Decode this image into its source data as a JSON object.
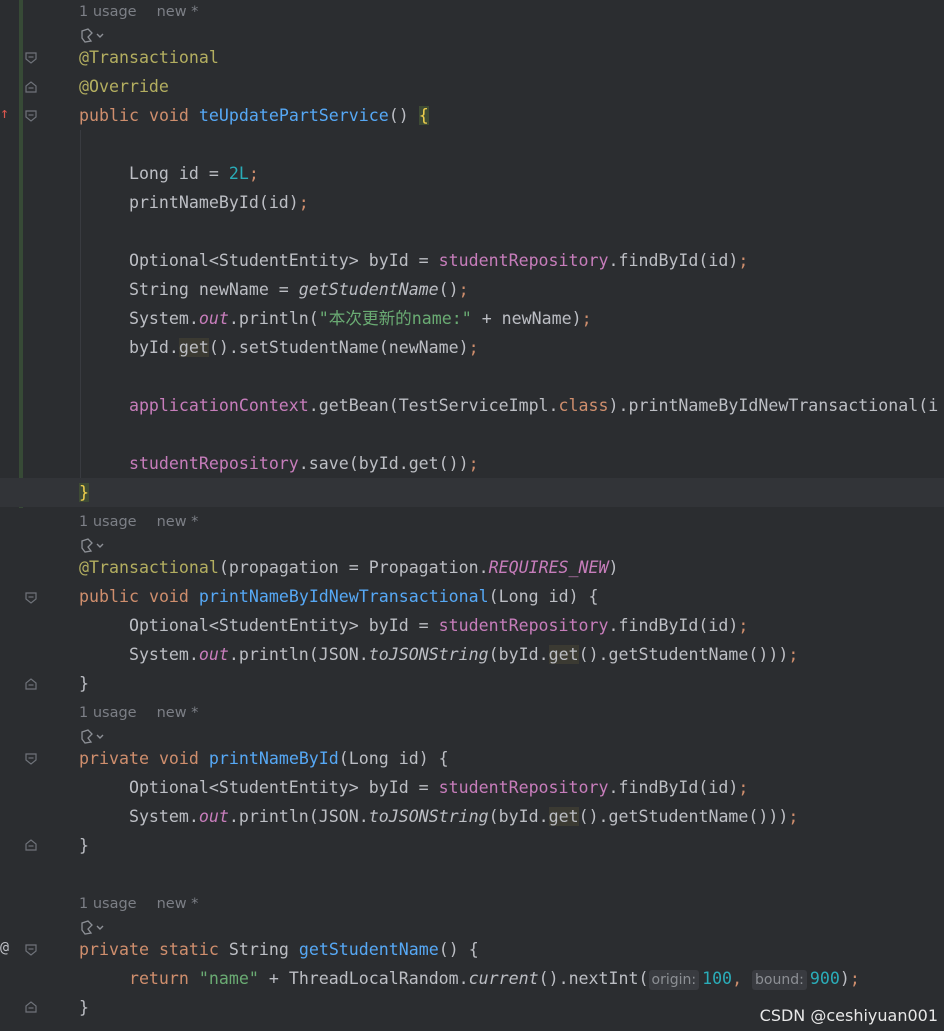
{
  "hints": {
    "usage": "1 usage",
    "new": "new *"
  },
  "gutter_marks": {
    "override_marker": "↑",
    "at_marker": "@"
  },
  "code": {
    "m1_ann1": "@Transactional",
    "m1_ann2": "@Override",
    "m1_decl": {
      "public": "public",
      "void": "void",
      "name": "teUpdatePartService",
      "parens": "() ",
      "brace": "{"
    },
    "l_long": {
      "type": "Long id = ",
      "num": "2L",
      "semi": ";"
    },
    "l_print": {
      "call": "printNameById(id)",
      "semi": ";"
    },
    "l_opt": {
      "a": "Optional<StudentEntity> byId = ",
      "field": "studentRepository",
      "b": ".findById(id)",
      "semi": ";"
    },
    "l_str": {
      "a": "String newName = ",
      "call": "getStudentName",
      "b": "()",
      "semi": ";"
    },
    "l_sys": {
      "a": "System.",
      "out": "out",
      "b": ".println(",
      "str": "\"本次更新的name:\"",
      "c": " + newName)",
      "semi": ";"
    },
    "l_set": {
      "a": "byId.",
      "get": "get",
      "b": "().setStudentName(newName)",
      "semi": ";"
    },
    "l_ctx": {
      "field": "applicationContext",
      "a": ".getBean(TestServiceImpl.",
      "cls": "class",
      "b": ").printNameByIdNewTransactional(i"
    },
    "l_save": {
      "field": "studentRepository",
      "a": ".save(byId.get())",
      "semi": ";"
    },
    "m1_close": "}",
    "m2_ann": {
      "ann": "@Transactional",
      "a": "(propagation = Propagation.",
      "const": "REQUIRES_NEW",
      "b": ")"
    },
    "m2_decl": {
      "public": "public",
      "void": "void",
      "name": "printNameByIdNewTransactional",
      "rest": "(Long id) {"
    },
    "l_opt2": {
      "a": "Optional<StudentEntity> byId = ",
      "field": "studentRepository",
      "b": ".findById(id)",
      "semi": ";"
    },
    "l_json": {
      "a": "System.",
      "out": "out",
      "b": ".println(JSON.",
      "fn": "toJSONString",
      "c": "(byId.",
      "get": "get",
      "d": "().getStudentName()))",
      "semi": ";"
    },
    "m2_close": "}",
    "m3_decl": {
      "private": "private",
      "void": "void",
      "name": "printNameById",
      "rest": "(Long id) {"
    },
    "l_opt3": {
      "a": "Optional<StudentEntity> byId = ",
      "field": "studentRepository",
      "b": ".findById(id)",
      "semi": ";"
    },
    "l_json3": {
      "a": "System.",
      "out": "out",
      "b": ".println(JSON.",
      "fn": "toJSONString",
      "c": "(byId.",
      "get": "get",
      "d": "().getStudentName()))",
      "semi": ";"
    },
    "m3_close": "}",
    "m4_decl": {
      "private": "private",
      "static": "static",
      "type": "String",
      "name": "getStudentName",
      "rest": "() {"
    },
    "l_return": {
      "ret": "return",
      "str": "\"name\"",
      "a": " + ThreadLocalRandom.",
      "cur": "current",
      "b": "().nextInt(",
      "origin_hint": "origin:",
      "origin": "100",
      "comma": ", ",
      "bound_hint": "bound:",
      "bound": "900",
      "c": ")",
      "semi": ";"
    },
    "m4_close": "}"
  },
  "watermark": "CSDN @ceshiyuan001"
}
